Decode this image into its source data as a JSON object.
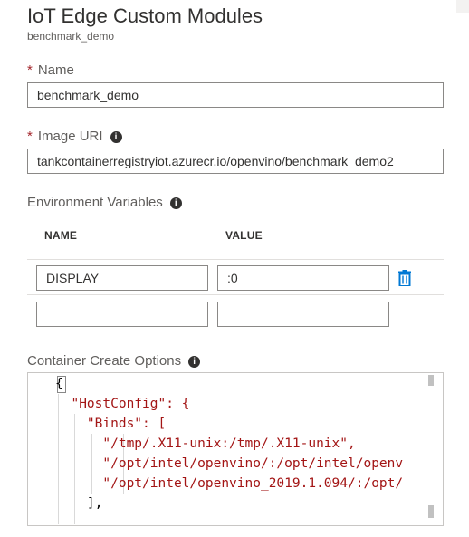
{
  "header": {
    "title": "IoT Edge Custom Modules",
    "subtitle": "benchmark_demo"
  },
  "name_field": {
    "label": "Name",
    "required_mark": "*",
    "value": "benchmark_demo"
  },
  "image_uri_field": {
    "label": "Image URI",
    "required_mark": "*",
    "value": "tankcontainerregistryiot.azurecr.io/openvino/benchmark_demo2"
  },
  "env_vars": {
    "label": "Environment Variables",
    "columns": [
      "NAME",
      "VALUE"
    ],
    "rows": [
      {
        "name": "DISPLAY",
        "value": ":0"
      },
      {
        "name": "",
        "value": ""
      }
    ]
  },
  "create_options": {
    "label": "Container Create Options",
    "lines": [
      "{",
      "  \"HostConfig\": {",
      "    \"Binds\": [",
      "      \"/tmp/.X11-unix:/tmp/.X11-unix\",",
      "      \"/opt/intel/openvino/:/opt/intel/openv",
      "      \"/opt/intel/openvino_2019.1.094/:/opt/",
      "    ],"
    ]
  },
  "icons": {
    "info": "info-icon",
    "delete": "trash-icon"
  },
  "colors": {
    "required": "#a4262c",
    "accent": "#0078d4",
    "string": "#a31515"
  }
}
